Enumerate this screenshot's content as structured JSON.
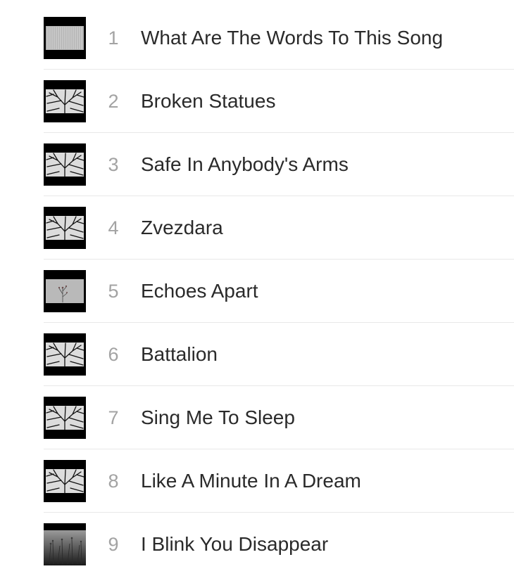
{
  "tracks": [
    {
      "number": "1",
      "title": "What Are The Words To This Song",
      "artwork": "rain-artwork-icon"
    },
    {
      "number": "2",
      "title": "Broken Statues",
      "artwork": "tree-branches-artwork-icon"
    },
    {
      "number": "3",
      "title": "Safe In Anybody's Arms",
      "artwork": "tree-branches-artwork-icon"
    },
    {
      "number": "4",
      "title": "Zvezdara",
      "artwork": "tree-branches-artwork-icon"
    },
    {
      "number": "5",
      "title": "Echoes Apart",
      "artwork": "flower-sprig-artwork-icon"
    },
    {
      "number": "6",
      "title": "Battalion",
      "artwork": "tree-branches-artwork-icon"
    },
    {
      "number": "7",
      "title": "Sing Me To Sleep",
      "artwork": "tree-branches-artwork-icon"
    },
    {
      "number": "8",
      "title": "Like A Minute In A Dream",
      "artwork": "tree-branches-artwork-icon"
    },
    {
      "number": "9",
      "title": "I Blink You Disappear",
      "artwork": "grass-artwork-icon"
    }
  ],
  "colors": {
    "title": "#2a2a2a",
    "number": "#a3a3a3",
    "divider": "#e8e8e8",
    "artwork_frame": "#000000"
  }
}
